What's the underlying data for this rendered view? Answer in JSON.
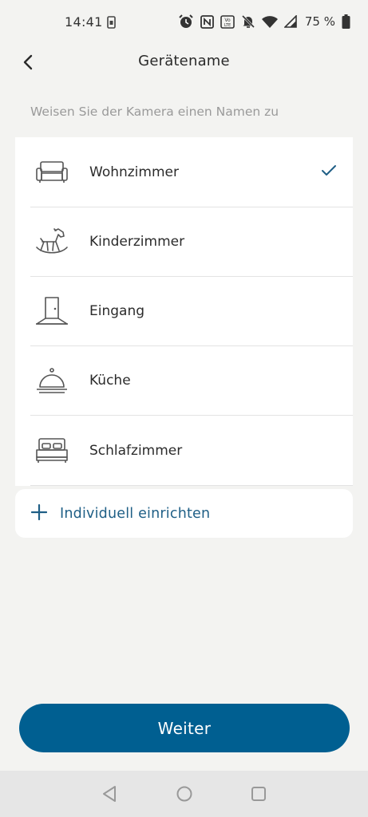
{
  "status_bar": {
    "time": "14:41",
    "battery": "75 %",
    "icons": [
      "sim-icon",
      "alarm-icon",
      "nfc-icon",
      "volte-icon",
      "mute-icon",
      "wifi-icon",
      "signal-icon",
      "battery-icon"
    ]
  },
  "header": {
    "title": "Gerätename",
    "back_icon": "chevron-left-icon"
  },
  "subtitle": "Weisen Sie der Kamera einen Namen zu",
  "rooms": [
    {
      "label": "Wohnzimmer",
      "icon": "sofa-icon",
      "selected": true
    },
    {
      "label": "Kinderzimmer",
      "icon": "rocking-horse-icon",
      "selected": false
    },
    {
      "label": "Eingang",
      "icon": "door-icon",
      "selected": false
    },
    {
      "label": "Küche",
      "icon": "cloche-icon",
      "selected": false
    },
    {
      "label": "Schlafzimmer",
      "icon": "bed-icon",
      "selected": false
    }
  ],
  "custom": {
    "label": "Individuell einrichten",
    "icon": "plus-icon"
  },
  "next_button": {
    "label": "Weiter"
  },
  "colors": {
    "background": "#f3f3f1",
    "accent": "#005f91",
    "link": "#1f5f86",
    "card": "#ffffff"
  },
  "nav_bar": {
    "icons": [
      "back-triangle-icon",
      "home-circle-icon",
      "recents-square-icon"
    ]
  }
}
